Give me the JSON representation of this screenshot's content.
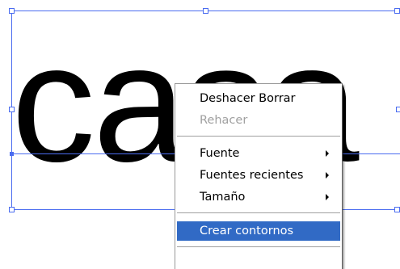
{
  "canvas": {
    "text": "casa"
  },
  "menu": {
    "items": [
      {
        "label": "Deshacer Borrar"
      },
      {
        "label": "Rehacer",
        "disabled": true
      },
      {
        "label": "Fuente",
        "submenu": true
      },
      {
        "label": "Fuentes recientes",
        "submenu": true
      },
      {
        "label": "Tamaño",
        "submenu": true
      },
      {
        "label": "Crear contornos",
        "highlighted": true
      }
    ]
  },
  "colors": {
    "selection": "#4a6cf0",
    "highlight": "#316ac5",
    "disabled_text": "#a0a0a0"
  }
}
